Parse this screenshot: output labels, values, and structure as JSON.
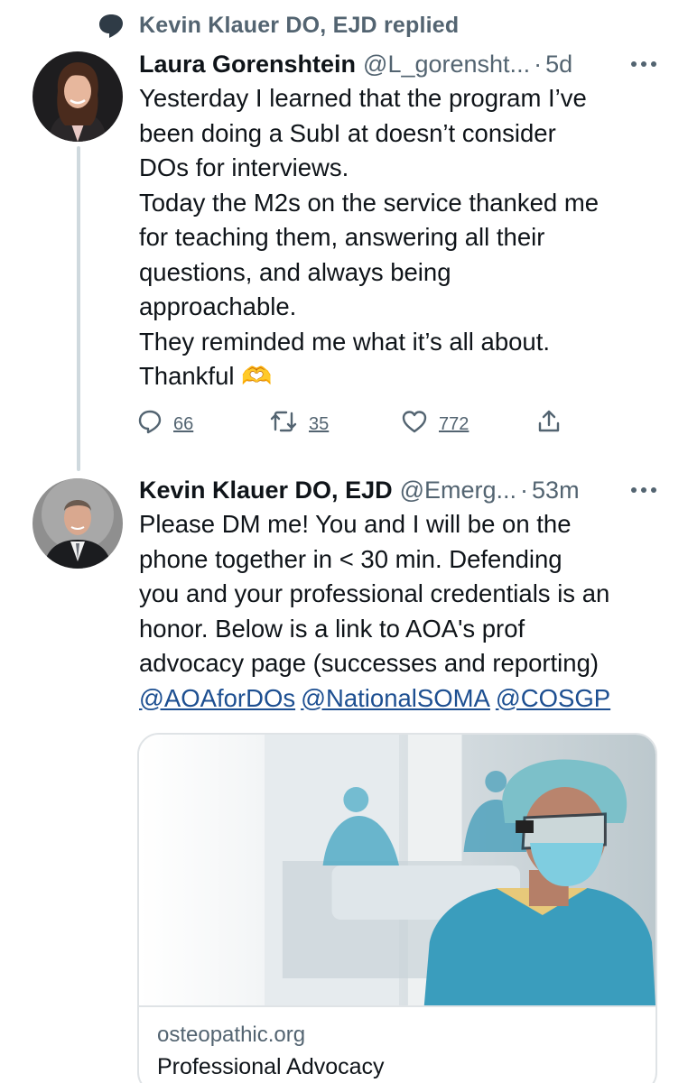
{
  "context": {
    "replied_label": "Kevin Klauer DO, EJD replied",
    "icon": "speech-bubble-icon"
  },
  "tweets": [
    {
      "author_name": "Laura Gorenshtein",
      "handle": "@L_gorensht...",
      "separator": "·",
      "time": "5d",
      "lines": [
        "Yesterday I learned that the program I’ve",
        "been doing a SubI at doesn’t consider",
        "DOs for interviews.",
        "Today the M2s on the service thanked me",
        "for teaching them, answering all their",
        "questions, and always being",
        "approachable.",
        "They reminded me what it’s all about.",
        "Thankful 🫶"
      ],
      "stats": {
        "replies": "66",
        "retweets": "35",
        "likes": "772"
      }
    },
    {
      "author_name": "Kevin Klauer DO, EJD",
      "handle": "@Emerg...",
      "separator": "·",
      "time": "53m",
      "lines": [
        "Please DM me! You and I will be on the",
        "phone together in < 30 min. Defending",
        "you and your professional credentials is an",
        "honor.  Below is a link to AOA's prof",
        "advocacy page (successes and reporting)"
      ],
      "mentions": [
        "@AOAforDOs",
        "@NationalSOMA",
        "@COSGP"
      ],
      "link_card": {
        "domain": "osteopathic.org",
        "title": "Professional Advocacy"
      }
    }
  ],
  "colors": {
    "text_primary": "#0f1419",
    "text_secondary": "#536471",
    "mention": "#1d4f91",
    "thread_line": "#cfd9de",
    "card_border": "#dfe3e6"
  }
}
